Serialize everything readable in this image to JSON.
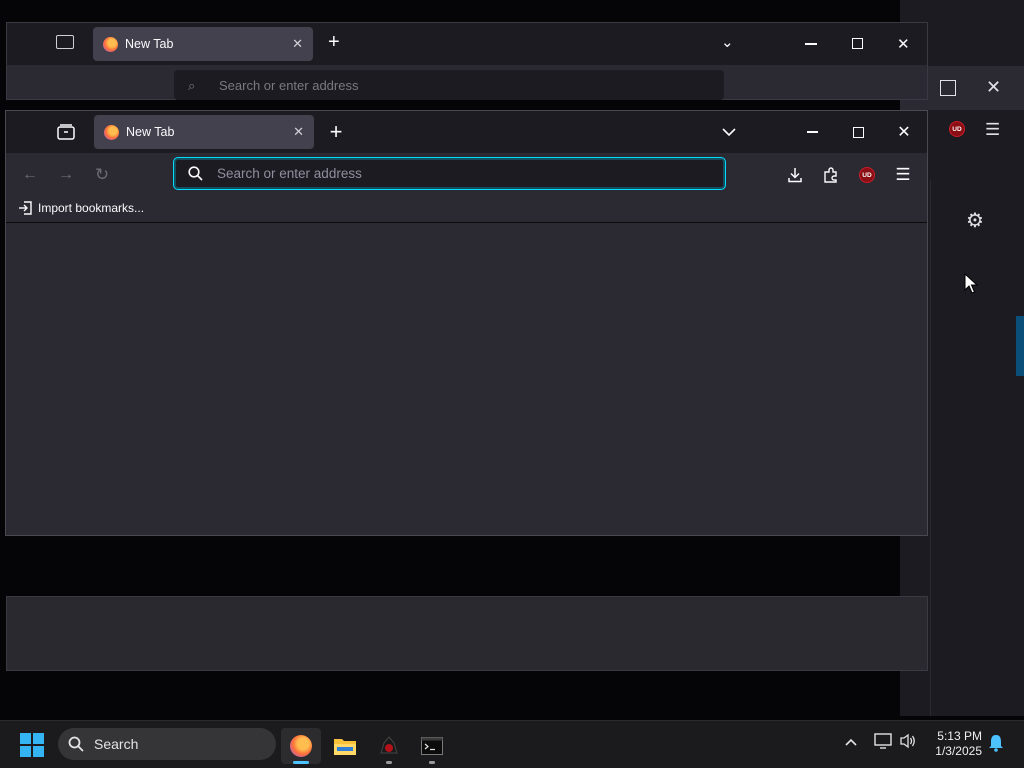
{
  "main_window": {
    "tab": {
      "title": "New Tab",
      "close_icon": "close-icon"
    },
    "new_tab_symbol": "+",
    "urlbar": {
      "placeholder": "Search or enter address",
      "value": ""
    },
    "bookmarks_toolbar": {
      "import_label": "Import bookmarks..."
    },
    "colors": {
      "frame": "#1c1b22",
      "toolbar": "#2b2a33",
      "tab_selected": "#42414d",
      "focus_ring": "#00ddff"
    }
  },
  "background_window": {
    "tab": {
      "title": "New Tab"
    },
    "urlbar": {
      "placeholder": "Search or enter address"
    }
  },
  "taskbar": {
    "search_label": "Search",
    "apps": [
      "firefox-icon",
      "file-explorer-icon",
      "app-icon",
      "terminal-icon"
    ],
    "clock": {
      "time": "5:13 PM",
      "date": "1/3/2025"
    },
    "colors": {
      "start_accent": "#34b4f2",
      "bar": "#1b1b1d"
    }
  }
}
